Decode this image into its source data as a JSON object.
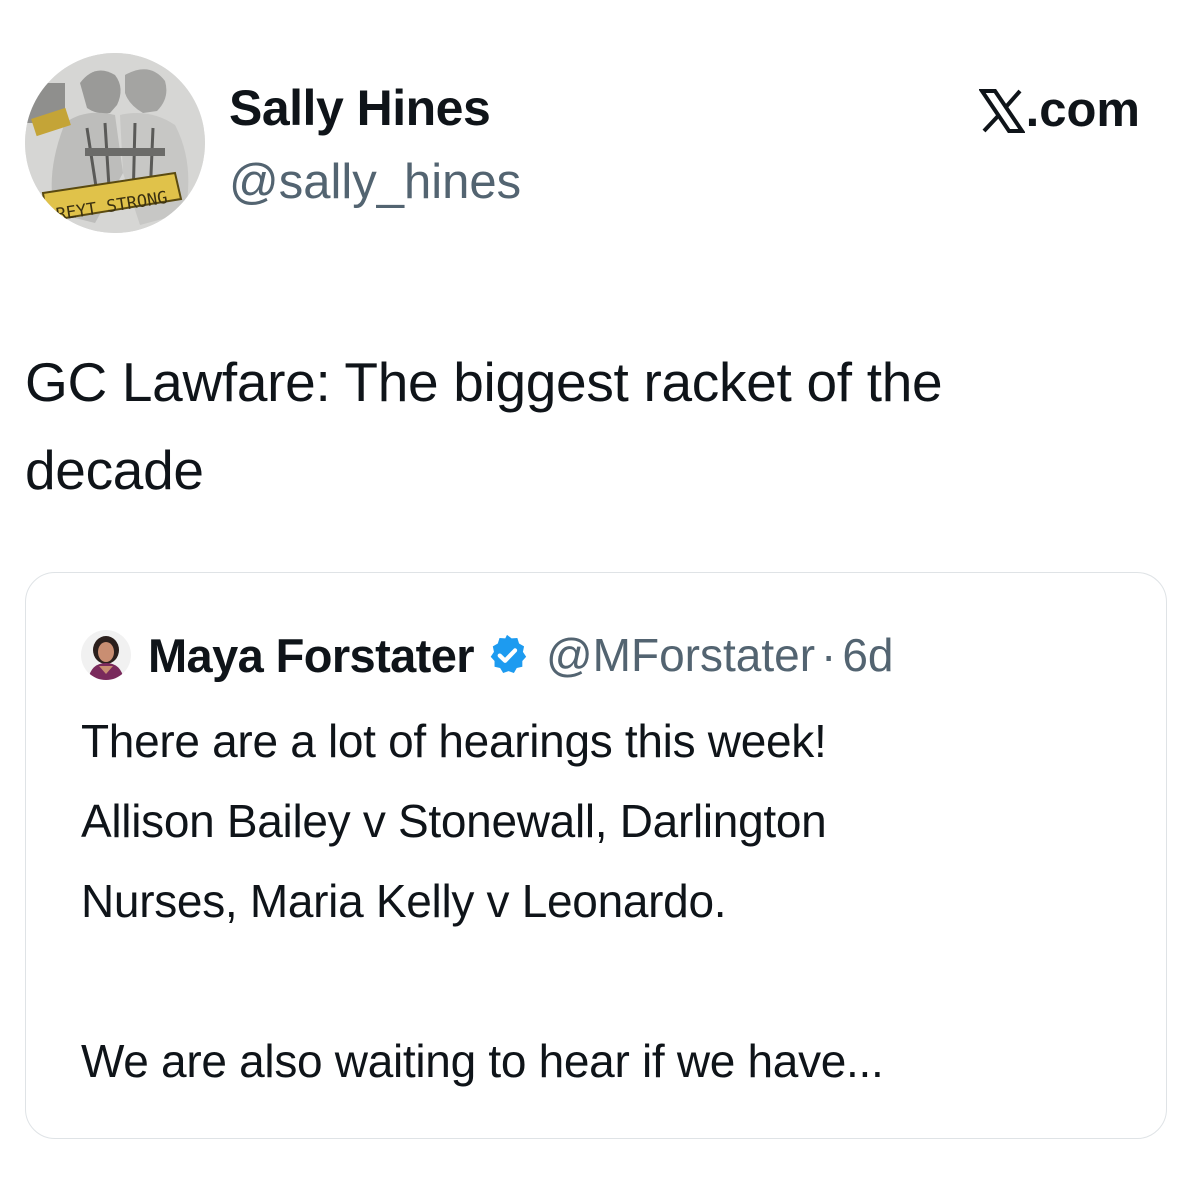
{
  "author": {
    "name": "Sally Hines",
    "handle": "@sally_hines",
    "avatar_icon": "avatar-illustration-icon",
    "avatar_text": "REYT STRONG"
  },
  "site": {
    "label": ".com",
    "logo_icon": "x-logo-icon"
  },
  "post": {
    "text": "GC Lawfare: The biggest racket of the decade"
  },
  "quoted": {
    "name": "Maya Forstater",
    "verified_icon": "verified-badge-icon",
    "handle": "@MForstater",
    "separator": "·",
    "time": "6d",
    "lines": [
      "There are a lot of hearings this week!",
      "Allison Bailey v Stonewall, Darlington",
      "Nurses, Maria Kelly v Leonardo."
    ],
    "truncated_line": "We are also waiting to hear if we have..."
  },
  "colors": {
    "text": "#0f1419",
    "secondary": "#536471",
    "verified": "#1d9bf0",
    "border": "#dfe3e6"
  }
}
